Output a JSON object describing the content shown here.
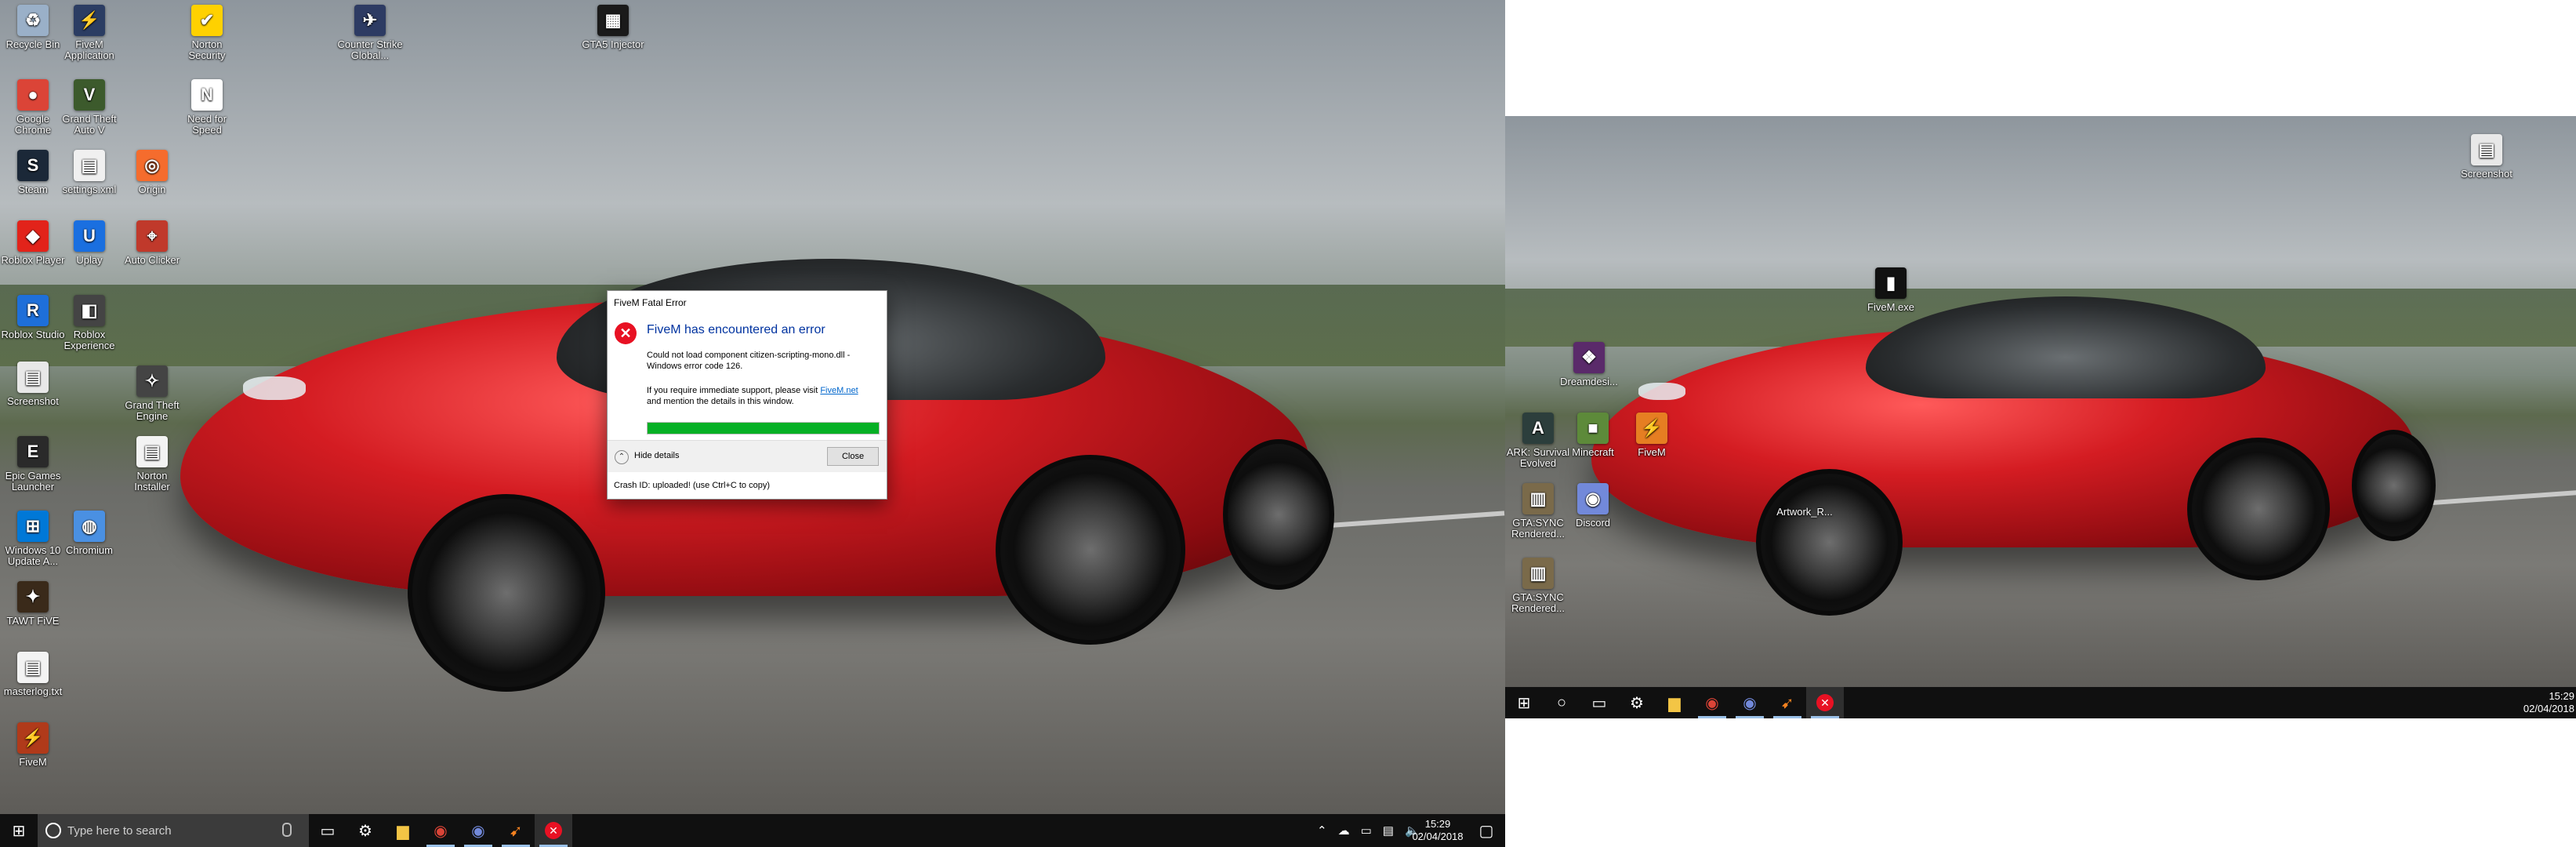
{
  "left_desktop": {
    "icons": [
      {
        "name": "recycle-bin-icon",
        "label": "Recycle Bin",
        "color": "#9ab0c8",
        "glyph": "♻"
      },
      {
        "name": "chrome-icon",
        "label": "Google Chrome",
        "color": "#db4437",
        "glyph": "●"
      },
      {
        "name": "steam-icon",
        "label": "Steam",
        "color": "#1b2838",
        "glyph": "S"
      },
      {
        "name": "roblox-player-icon",
        "label": "Roblox Player",
        "color": "#e2231a",
        "glyph": "◆"
      },
      {
        "name": "roblox-studio-icon",
        "label": "Roblox Studio",
        "color": "#1e6fd9",
        "glyph": "R"
      },
      {
        "name": "file-icon",
        "label": "Screenshot",
        "color": "#e8e8e8",
        "glyph": "▤"
      },
      {
        "name": "epic-games-icon",
        "label": "Epic Games Launcher",
        "color": "#2a2a2a",
        "glyph": "E"
      },
      {
        "name": "windows-update-icon",
        "label": "Windows 10 Update A...",
        "color": "#0078d7",
        "glyph": "⊞"
      },
      {
        "name": "tawt-icon",
        "label": "TAWT FiVE",
        "color": "#3a2a1a",
        "glyph": "✦"
      },
      {
        "name": "text-file-icon",
        "label": "masterlog.txt",
        "color": "#f3f3f3",
        "glyph": "▤"
      },
      {
        "name": "fivem-icon",
        "label": "FiveM",
        "color": "#b03a1a",
        "glyph": "⚡"
      },
      {
        "name": "fivem-app-icon",
        "label": "FiveM Application",
        "color": "#2b3d63",
        "glyph": "⚡"
      },
      {
        "name": "gta-icon",
        "label": "Grand Theft Auto V",
        "color": "#3c5a2c",
        "glyph": "V"
      },
      {
        "name": "settings-file-icon",
        "label": "settings.xml",
        "color": "#f0f0f0",
        "glyph": "▤"
      },
      {
        "name": "uplay-icon",
        "label": "Uplay",
        "color": "#1a6fe0",
        "glyph": "U"
      },
      {
        "name": "roblox-experience-icon",
        "label": "Roblox Experience",
        "color": "#444",
        "glyph": "◧"
      },
      {
        "name": "norton-security-icon",
        "label": "Norton Security",
        "color": "#ffd100",
        "glyph": "✔"
      },
      {
        "name": "nfs-icon",
        "label": "Need for Speed",
        "color": "#ffffff",
        "glyph": "N"
      },
      {
        "name": "origin-icon",
        "label": "Origin",
        "color": "#f56c2d",
        "glyph": "◎"
      },
      {
        "name": "auto-clicker-icon",
        "label": "Auto Clicker",
        "color": "#c0392b",
        "glyph": "⌖"
      },
      {
        "name": "chromium-icon",
        "label": "Chromium",
        "color": "#4a90e2",
        "glyph": "◍"
      },
      {
        "name": "grand-theft-launcher-icon",
        "label": "Grand Theft Engine",
        "color": "#444",
        "glyph": "✧"
      },
      {
        "name": "norton-installer-icon",
        "label": "Norton Installer",
        "color": "#f3f3f3",
        "glyph": "▤"
      },
      {
        "name": "counter-strike-icon",
        "label": "Counter Strike Global...",
        "color": "#2d3b63",
        "glyph": "✈"
      },
      {
        "name": "fivem-injector-icon",
        "label": "GTA5 Injector",
        "color": "#1a1a1a",
        "glyph": "▦"
      }
    ]
  },
  "left_taskbar": {
    "search_placeholder": "Type here to search",
    "time": "15:29",
    "date": "02/04/2018"
  },
  "dialog": {
    "window_title": "FiveM Fatal Error",
    "heading": "FiveM has encountered an error",
    "message": "Could not load component citizen-scripting-mono.dll - Windows error code 126.",
    "support_prefix": "If you require immediate support, please visit ",
    "support_link": "FiveM.net",
    "support_suffix": " and mention the details in this window.",
    "progress_fraction": 1.0,
    "hide_details": "Hide details",
    "close_label": "Close",
    "crash_id": "Crash ID: uploaded! (use Ctrl+C to copy)"
  },
  "right_desktop": {
    "icons": [
      {
        "name": "screenshot-icon",
        "label": "Screenshot",
        "color": "#e8e8e8",
        "glyph": "▤"
      },
      {
        "name": "fivem-app-icon",
        "label": "FiveM.exe",
        "color": "#111",
        "glyph": "▮"
      },
      {
        "name": "dream-icon",
        "label": "Dreamdesi...",
        "color": "#5a2a6a",
        "glyph": "❖"
      },
      {
        "name": "ark-icon",
        "label": "ARK: Survival Evolved",
        "color": "#2c3e3c",
        "glyph": "A"
      },
      {
        "name": "minecraft-icon",
        "label": "Minecraft",
        "color": "#5d8a3a",
        "glyph": "■"
      },
      {
        "name": "flash-icon",
        "label": "FiveM",
        "color": "#e67e22",
        "glyph": "⚡"
      },
      {
        "name": "gta-san-icon",
        "label": "GTA:SYNC Rendered...",
        "color": "#7a6a4a",
        "glyph": "▥"
      },
      {
        "name": "discord-icon",
        "label": "Discord",
        "color": "#7289da",
        "glyph": "◉"
      },
      {
        "name": "gta-san2-icon",
        "label": "GTA:SYNC Rendered...",
        "color": "#7a6a4a",
        "glyph": "▥"
      },
      {
        "name": "artwork-label",
        "label": "Artwork_R...",
        "color": "transparent",
        "glyph": ""
      }
    ]
  },
  "right_taskbar": {
    "time": "15:29",
    "date": "02/04/2018"
  }
}
